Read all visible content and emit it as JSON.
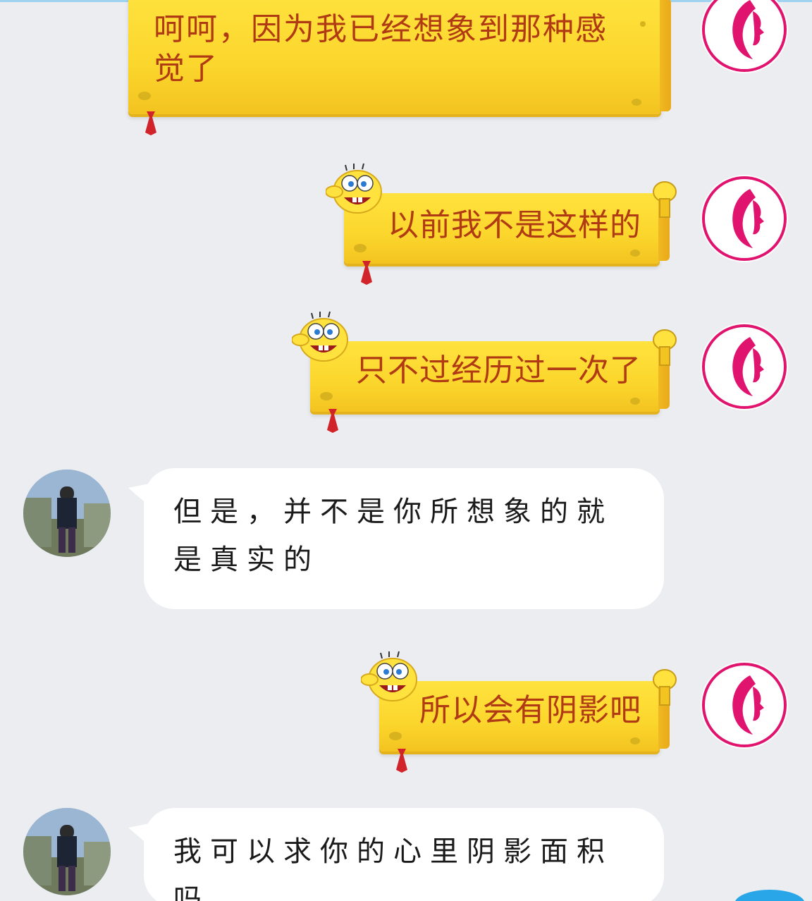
{
  "messages": [
    {
      "side": "right",
      "style": "sponge",
      "text": "呵呵，因为我已经想象到那种感觉了"
    },
    {
      "side": "right",
      "style": "sponge",
      "text": "以前我不是这样的"
    },
    {
      "side": "right",
      "style": "sponge",
      "text": "只不过经历过一次了"
    },
    {
      "side": "left",
      "style": "plain",
      "text": "但是，并不是你所想象的就是真实的"
    },
    {
      "side": "right",
      "style": "sponge",
      "text": "所以会有阴影吧"
    },
    {
      "side": "left",
      "style": "plain",
      "text": "我可以求你的心里阴影面积吗"
    }
  ],
  "colors": {
    "background": "#ebedf1",
    "sponge_text": "#b03a14",
    "sponge_fill": "#fbd62c",
    "self_avatar_accent": "#e0136f",
    "plain_text": "#1a1a1a"
  },
  "icons": {
    "self_avatar": "female-profile-logo-icon",
    "peer_avatar": "person-photo-avatar",
    "bubble_face": "spongebob-face-icon",
    "bubble_thumb": "thumbs-up-icon",
    "bubble_tie": "red-tie-icon"
  }
}
